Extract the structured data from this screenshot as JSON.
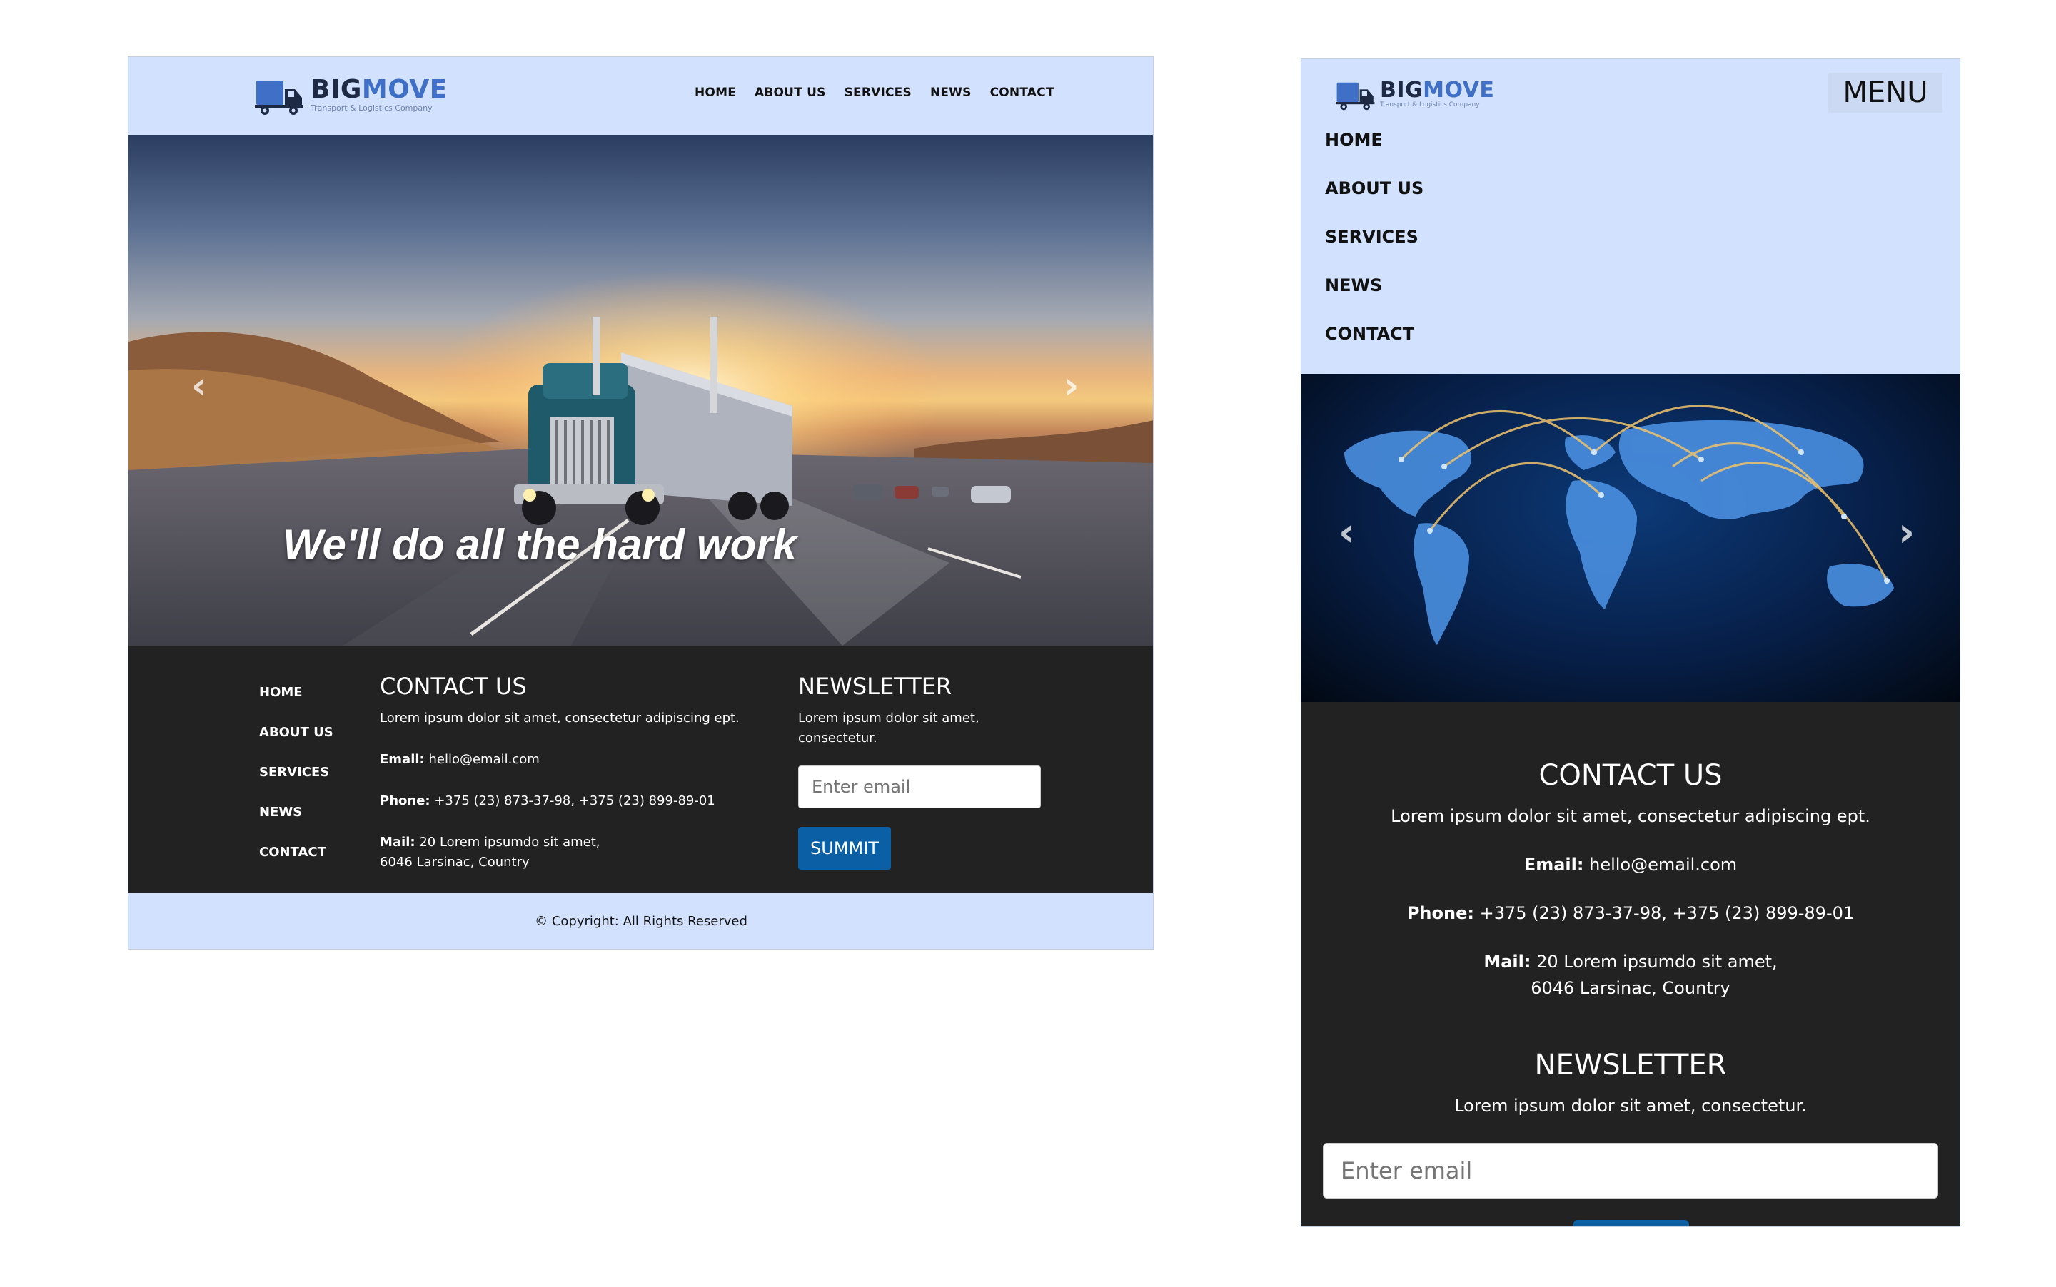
{
  "brand": {
    "part1": "BIG",
    "part2": "MOVE",
    "tagline": "Transport & Logistics Company"
  },
  "nav": [
    {
      "label": "HOME"
    },
    {
      "label": "ABOUT US"
    },
    {
      "label": "SERVICES"
    },
    {
      "label": "NEWS"
    },
    {
      "label": "CONTACT"
    }
  ],
  "hero": {
    "caption": "We'll do all the hard work",
    "prev_icon": "chevron-left-icon",
    "next_icon": "chevron-right-icon",
    "prev_glyph": "‹",
    "next_glyph": "›"
  },
  "contact": {
    "title": "CONTACT US",
    "intro": "Lorem ipsum dolor sit amet, consectetur adipiscing ept.",
    "email_label": "Email:",
    "email_value": "hello@email.com",
    "phone_label": "Phone:",
    "phone_value": "+375 (23) 873-37-98, +375 (23) 899-89-01",
    "mail_label": "Mail:",
    "mail_line1": "20 Lorem ipsumdo sit amet,",
    "mail_line2": "6046 Larsinac, Country"
  },
  "newsletter": {
    "title": "NEWSLETTER",
    "intro": "Lorem ipsum dolor sit amet, consectetur.",
    "intro_line1": "Lorem ipsum dolor sit amet,",
    "intro_line2": "consectetur.",
    "email_placeholder": "Enter email",
    "submit_label": "SUMMIT"
  },
  "copyright": "© Copyright: All Rights Reserved",
  "mobile": {
    "menu_label": "MENU"
  },
  "colors": {
    "header_bg": "#d2e1fd",
    "footer_bg": "#222222",
    "accent": "#0b5fa5",
    "brand_dark": "#1e2a44",
    "brand_blue": "#3f6fc7"
  }
}
